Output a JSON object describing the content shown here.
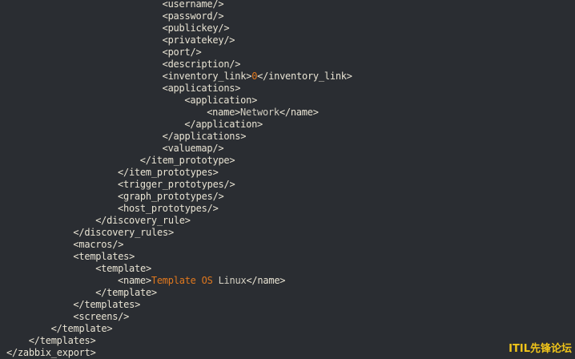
{
  "colors": {
    "background": "#2a2d32",
    "tag": "#e8e3d3",
    "text": "#d3cfc2",
    "accent": "#e0781e",
    "watermark": "#f0c419"
  },
  "watermark": "ITIL先锋论坛",
  "lines": [
    {
      "indent": 7,
      "tokens": [
        {
          "t": "<username/>",
          "k": "tag"
        }
      ]
    },
    {
      "indent": 7,
      "tokens": [
        {
          "t": "<password/>",
          "k": "tag"
        }
      ]
    },
    {
      "indent": 7,
      "tokens": [
        {
          "t": "<publickey/>",
          "k": "tag"
        }
      ]
    },
    {
      "indent": 7,
      "tokens": [
        {
          "t": "<privatekey/>",
          "k": "tag"
        }
      ]
    },
    {
      "indent": 7,
      "tokens": [
        {
          "t": "<port/>",
          "k": "tag"
        }
      ]
    },
    {
      "indent": 7,
      "tokens": [
        {
          "t": "<description/>",
          "k": "tag"
        }
      ]
    },
    {
      "indent": 7,
      "tokens": [
        {
          "t": "<inventory_link>",
          "k": "tag"
        },
        {
          "t": "0",
          "k": "accent"
        },
        {
          "t": "</inventory_link>",
          "k": "tag"
        }
      ]
    },
    {
      "indent": 7,
      "tokens": [
        {
          "t": "<applications>",
          "k": "tag"
        }
      ]
    },
    {
      "indent": 8,
      "tokens": [
        {
          "t": "<application>",
          "k": "tag"
        }
      ]
    },
    {
      "indent": 9,
      "tokens": [
        {
          "t": "<name>",
          "k": "tag"
        },
        {
          "t": "Network",
          "k": "text"
        },
        {
          "t": "</name>",
          "k": "tag"
        }
      ]
    },
    {
      "indent": 8,
      "tokens": [
        {
          "t": "</application>",
          "k": "tag"
        }
      ]
    },
    {
      "indent": 7,
      "tokens": [
        {
          "t": "</applications>",
          "k": "tag"
        }
      ]
    },
    {
      "indent": 7,
      "tokens": [
        {
          "t": "<valuemap/>",
          "k": "tag"
        }
      ]
    },
    {
      "indent": 6,
      "tokens": [
        {
          "t": "</item_prototype>",
          "k": "tag"
        }
      ]
    },
    {
      "indent": 5,
      "tokens": [
        {
          "t": "</item_prototypes>",
          "k": "tag"
        }
      ]
    },
    {
      "indent": 5,
      "tokens": [
        {
          "t": "<trigger_prototypes/>",
          "k": "tag"
        }
      ]
    },
    {
      "indent": 5,
      "tokens": [
        {
          "t": "<graph_prototypes/>",
          "k": "tag"
        }
      ]
    },
    {
      "indent": 5,
      "tokens": [
        {
          "t": "<host_prototypes/>",
          "k": "tag"
        }
      ]
    },
    {
      "indent": 4,
      "tokens": [
        {
          "t": "</discovery_rule>",
          "k": "tag"
        }
      ]
    },
    {
      "indent": 3,
      "tokens": [
        {
          "t": "</discovery_rules>",
          "k": "tag"
        }
      ]
    },
    {
      "indent": 3,
      "tokens": [
        {
          "t": "<macros/>",
          "k": "tag"
        }
      ]
    },
    {
      "indent": 3,
      "tokens": [
        {
          "t": "<templates>",
          "k": "tag"
        }
      ]
    },
    {
      "indent": 4,
      "tokens": [
        {
          "t": "<template>",
          "k": "tag"
        }
      ]
    },
    {
      "indent": 5,
      "tokens": [
        {
          "t": "<name>",
          "k": "tag"
        },
        {
          "t": "Template OS",
          "k": "accent"
        },
        {
          "t": " Linux",
          "k": "text"
        },
        {
          "t": "</name>",
          "k": "tag"
        }
      ]
    },
    {
      "indent": 4,
      "tokens": [
        {
          "t": "</template>",
          "k": "tag"
        }
      ]
    },
    {
      "indent": 3,
      "tokens": [
        {
          "t": "</templates>",
          "k": "tag"
        }
      ]
    },
    {
      "indent": 3,
      "tokens": [
        {
          "t": "<screens/>",
          "k": "tag"
        }
      ]
    },
    {
      "indent": 2,
      "tokens": [
        {
          "t": "</template>",
          "k": "tag"
        }
      ]
    },
    {
      "indent": 1,
      "tokens": [
        {
          "t": "</templates>",
          "k": "tag"
        }
      ]
    },
    {
      "indent": 0,
      "tokens": [
        {
          "t": "</zabbix_export>",
          "k": "tag"
        }
      ]
    }
  ]
}
